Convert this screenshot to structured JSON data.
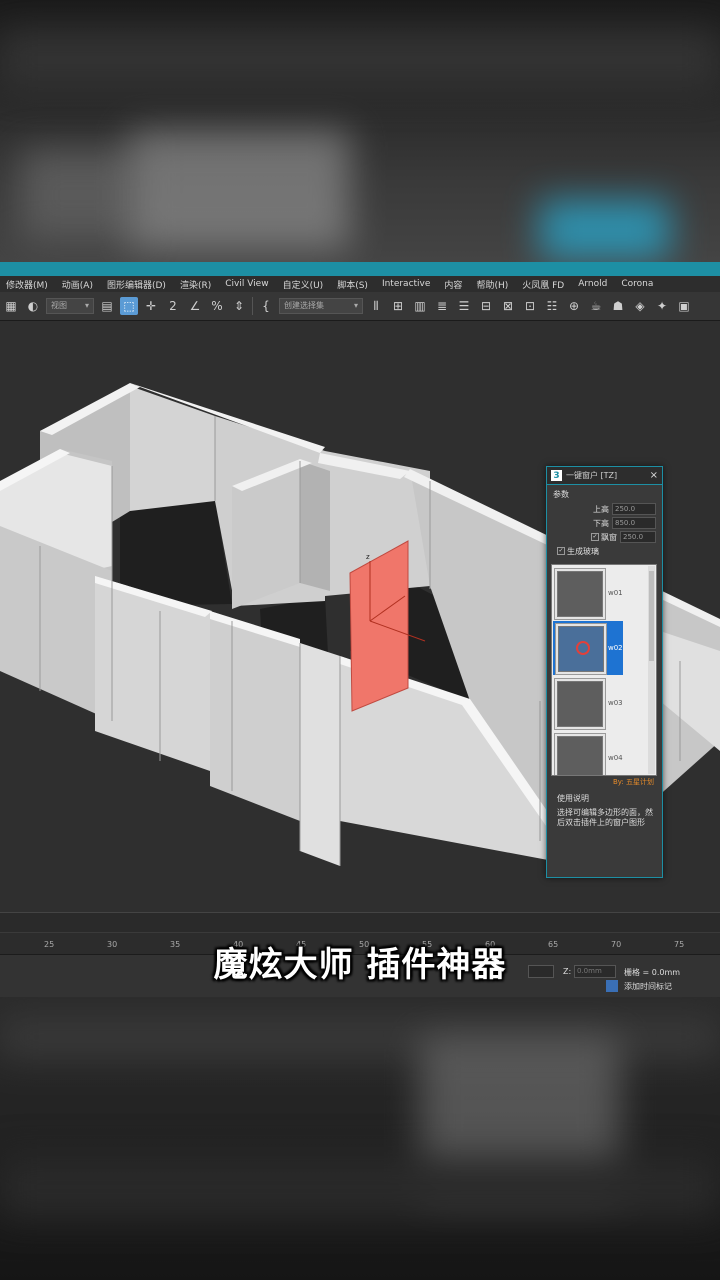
{
  "menu": {
    "items": [
      "修改器(M)",
      "动画(A)",
      "图形编辑器(D)",
      "渲染(R)",
      "Civil View",
      "自定义(U)",
      "脚本(S)",
      "Interactive",
      "内容",
      "帮助(H)",
      "火凤凰 FD",
      "Arnold",
      "Corona"
    ]
  },
  "toolbar": {
    "view_select": "视图",
    "selection_set": "创建选择集"
  },
  "dialog": {
    "title": "一键窗户 [TZ]",
    "section_params": "参数",
    "upper_height_label": "上高",
    "upper_height_value": "250.0",
    "lower_height_label": "下高",
    "lower_height_value": "850.0",
    "sill_label": "飘窗",
    "sill_value": "250.0",
    "glass_label": "生成玻璃",
    "thumbs": [
      {
        "label": "w01"
      },
      {
        "label": "w02"
      },
      {
        "label": "w03"
      },
      {
        "label": "w04"
      }
    ],
    "author": "By: 五星计划",
    "usage_title": "使用说明",
    "usage_text": "选择可编辑多边形的面，然后双击插件上的窗户图形"
  },
  "timeline": {
    "ticks": [
      "25",
      "30",
      "35",
      "40",
      "45",
      "50",
      "55",
      "60",
      "65",
      "70",
      "75"
    ]
  },
  "status": {
    "z_label": "Z:",
    "z_value": "0.0mm",
    "grid": "栅格 = 0.0mm",
    "add_key": "添加时间标记"
  },
  "caption": "魔炫大师 插件神器",
  "colors": {
    "accent": "#1d8fa4",
    "selection": "#1e73d2",
    "selected_face": "#f0766a",
    "author": "#e48a2a"
  }
}
